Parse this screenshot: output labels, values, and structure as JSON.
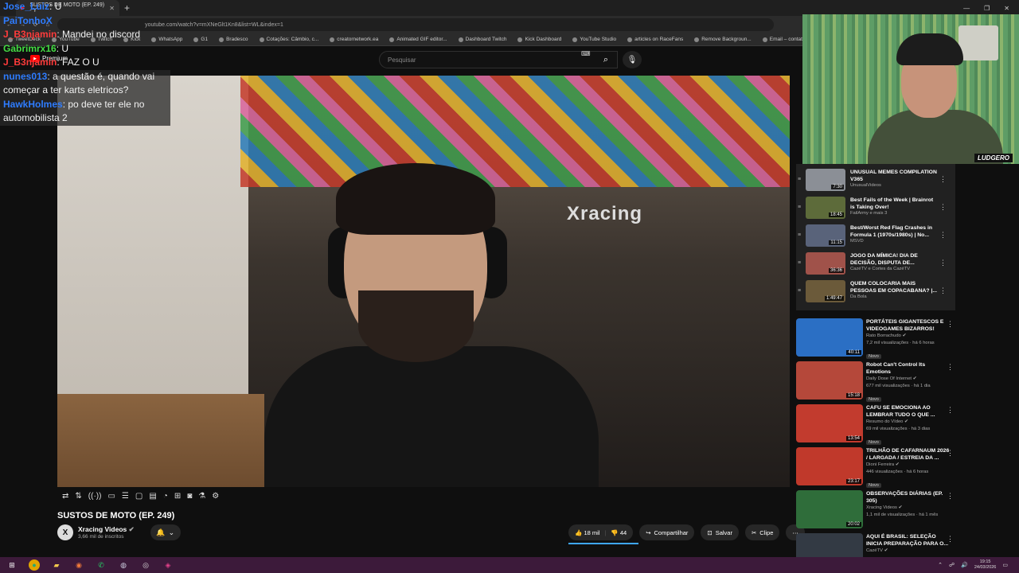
{
  "browser": {
    "tab_title": "SUSTOS DE MOTO (EP. 249) - Y",
    "url": "youtube.com/watch?v=mXNeGlt1Kn8&list=WL&index=1",
    "bookmarks": [
      "TweetDeck",
      "YouTube",
      "Twitch",
      "Kick",
      "WhatsApp",
      "G1",
      "Bradesco",
      "Cotações: Câmbio, c...",
      "creatornetwork.ea",
      "Animated GIF editor...",
      "Dashboard Twitch",
      "Kick Dashboard",
      "YouTube Studio",
      "articles on RaceFans",
      "Remove Backgroun...",
      "Email – contato",
      "F1 Schedule 2026",
      "Not"
    ]
  },
  "youtube": {
    "logo_text": "Premium",
    "search_placeholder": "Pesquisar",
    "video_title": "SUSTOS DE MOTO (EP. 249)",
    "channel_name": "Xracing Videos",
    "channel_initial": "X",
    "subscribers": "3,66 mil de inscritos",
    "likes": "18 mil",
    "dislikes": "44",
    "share": "Compartilhar",
    "save": "Salvar",
    "clip": "Clipe",
    "video_brand": "Xracing"
  },
  "chat": [
    {
      "user": "Jose_Luiz",
      "msg": "U",
      "color": "#2e7cff",
      "bg": false
    },
    {
      "user": "PaiTonhoX",
      "msg": "",
      "color": "#2e7cff",
      "bg": false
    },
    {
      "user": "J_B3njamin",
      "msg": "Mandei no discord",
      "color": "#ff3b3b",
      "bg": false
    },
    {
      "user": "Gabrimrx16",
      "msg": "U",
      "color": "#44dd44",
      "bg": false
    },
    {
      "user": "J_B3njamin",
      "msg": "FAZ O U",
      "color": "#ff3b3b",
      "bg": false
    },
    {
      "user": "nunes013",
      "msg": "a questão é, quando vai começar a ter karts eletricos?",
      "color": "#2e7cff",
      "bg": true
    },
    {
      "user": "HawkHolmes",
      "msg": "po deve ter ele no automobilista 2",
      "color": "#2e7cff",
      "bg": true
    }
  ],
  "webcam": {
    "tag": "LUDGERO"
  },
  "playlist": [
    {
      "title": "UNUSUAL MEMES COMPILATION V365",
      "meta": "UnusualVideos",
      "duration": "7:30"
    },
    {
      "title": "Best Fails of the Week | Brainrot is Taking Over!",
      "meta": "FailArmy e mais 3",
      "duration": "18:45"
    },
    {
      "title": "Best/Worst Red Flag Crashes in Formula 1 (1970s/1980s) | No...",
      "meta": "MSVD",
      "duration": "11:15"
    },
    {
      "title": "JOGO DA MÍMICA! DIA DE DECISÃO, DISPUTA DE...",
      "meta": "CazéTV e Cortes da CazéTV",
      "duration": "36:36"
    },
    {
      "title": "QUEM COLOCARIA MAIS PESSOAS EM COPACABANA? |...",
      "meta": "Da Bola",
      "duration": "1:49:47"
    }
  ],
  "recommendations": [
    {
      "title": "PORTÁTEIS GIGANTESCOS E VIDEOGAMES BIZARROS!",
      "channel": "Rato Borrachudo",
      "stats": "7,2 mil visualizações · há 6 horas",
      "badge": "Novo",
      "duration": "40:11",
      "color": "#2b6fc4"
    },
    {
      "title": "Robot Can't Control Its Emotions",
      "channel": "Daily Dose Of Internet",
      "stats": "677 mil visualizações · há 1 dia",
      "badge": "Novo",
      "duration": "15:18",
      "color": "#b5483a"
    },
    {
      "title": "CAFU SE EMOCIONA AO LEMBRAR TUDO O QUE ...",
      "channel": "Resumo do Vídeo",
      "stats": "69 mil visualizações · há 3 dias",
      "badge": "Novo",
      "duration": "13:54",
      "color": "#c23b2e"
    },
    {
      "title": "TRILHÃO DE CAFARNAUM 2026 / LARGADA / ESTREIA DA ...",
      "channel": "Dioni Ferreira",
      "stats": "446 visualizações · há 6 horas",
      "badge": "Novo",
      "duration": "23:17",
      "color": "#c0392b"
    },
    {
      "title": "OBSERVAÇÕES DIÁRIAS (EP. 305)",
      "channel": "Xracing Videos",
      "stats": "1,1 mil de visualizações · há 1 mês",
      "badge": "",
      "duration": "20:02",
      "color": "#2f6d3a"
    },
    {
      "title": "AQUI É BRASIL: SELEÇÃO INICIA PREPARAÇÃO PARA O...",
      "channel": "CazéTV",
      "stats": "",
      "badge": "",
      "duration": "",
      "color": "#333a44"
    }
  ],
  "taskbar": {
    "time": "19:15",
    "date": "24/03/2026"
  },
  "colors": {
    "accent": "#3ea6ff",
    "brand_red": "#ff0000"
  }
}
